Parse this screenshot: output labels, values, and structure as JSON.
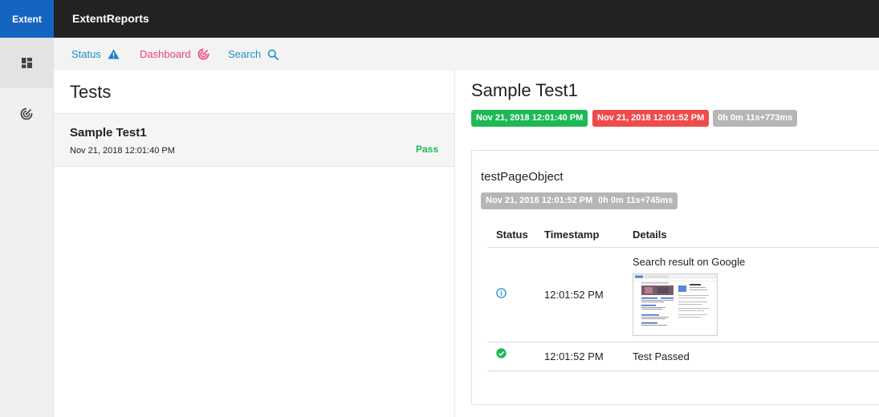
{
  "brand": "Extent",
  "app_title": "ExtentReports",
  "rail": [
    {
      "icon": "dashboard-grid-icon",
      "active": true
    },
    {
      "icon": "radar-icon",
      "active": false
    }
  ],
  "nav": {
    "status": {
      "label": "Status",
      "icon": "warning-triangle-icon",
      "color": "#1a93c7"
    },
    "dashboard": {
      "label": "Dashboard",
      "icon": "target-icon",
      "color": "#e8437a"
    },
    "search": {
      "label": "Search",
      "icon": "search-icon",
      "color": "#1a93c7"
    }
  },
  "tests": {
    "heading": "Tests",
    "items": [
      {
        "name": "Sample Test1",
        "time": "Nov 21, 2018 12:01:40 PM",
        "status": "Pass"
      }
    ]
  },
  "detail": {
    "title": "Sample Test1",
    "start": "Nov 21, 2018 12:01:40 PM",
    "end": "Nov 21, 2018 12:01:52 PM",
    "duration": "0h 0m 11s+773ms",
    "node": {
      "name": "testPageObject",
      "time": "Nov 21, 2018 12:01:52 PM",
      "duration": "0h 0m 11s+745ms",
      "columns": [
        "Status",
        "Timestamp",
        "Details"
      ],
      "logs": [
        {
          "status_icon": "info-circle-icon",
          "timestamp": "12:01:52 PM",
          "details": "Search result on Google"
        },
        {
          "status_icon": "check-circle-icon",
          "timestamp": "12:01:52 PM",
          "details": "Test Passed"
        }
      ]
    }
  },
  "colors": {
    "pass": "#1db954",
    "fail": "#ef4b4b",
    "neutral": "#b6b6b6",
    "brand": "#1565c0",
    "info": "#1a93c7"
  }
}
